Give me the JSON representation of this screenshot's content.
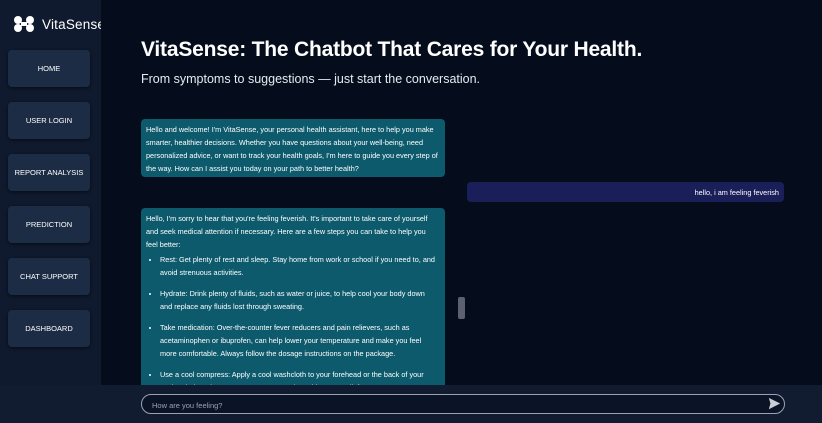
{
  "app": {
    "name": "VitaSense"
  },
  "sidebar": {
    "items": [
      {
        "label": "HOME"
      },
      {
        "label": "USER LOGIN"
      },
      {
        "label": "REPORT ANALYSIS"
      },
      {
        "label": "PREDICTION"
      },
      {
        "label": "CHAT SUPPORT"
      },
      {
        "label": "DASHBOARD"
      }
    ]
  },
  "header": {
    "title": "VitaSense: The Chatbot That Cares for Your Health.",
    "subtitle": "From symptoms to suggestions — just start the conversation."
  },
  "chat": {
    "messages": [
      {
        "role": "bot",
        "text": "Hello and welcome! I'm VitaSense, your personal health assistant, here to help you make smarter, healthier decisions. Whether you have questions about your well-being, need personalized advice, or want to track your health goals, I'm here to guide you every step of the way. How can I assist you today on your path to better health?"
      },
      {
        "role": "user",
        "text": "hello, i am feeling feverish"
      },
      {
        "role": "bot",
        "intro": "Hello, I'm sorry to hear that you're feeling feverish. It's important to take care of yourself and seek medical attention if necessary. Here are a few steps you can take to help you feel better:",
        "bullets": [
          "Rest: Get plenty of rest and sleep. Stay home from work or school if you need to, and avoid strenuous activities.",
          "Hydrate: Drink plenty of fluids, such as water or juice, to help cool your body down and replace any fluids lost through sweating.",
          "Take medication: Over-the-counter fever reducers and pain relievers, such as acetaminophen or ibuprofen, can help lower your temperature and make you feel more comfortable. Always follow the dosage instructions on the package.",
          "Use a cool compress: Apply a cool washcloth to your forehead or the back of your neck to help reduce your temperature and provide some relief."
        ]
      }
    ]
  },
  "input": {
    "placeholder": "How are you feeling?",
    "value": ""
  },
  "icons": {
    "logo": "logo-icon",
    "send": "send-icon"
  },
  "colors": {
    "bot_bubble": "#0d5a6d",
    "user_bubble": "#1a1f5a",
    "sidebar": "#0f1a2e",
    "main_bg": "#050c1b"
  }
}
